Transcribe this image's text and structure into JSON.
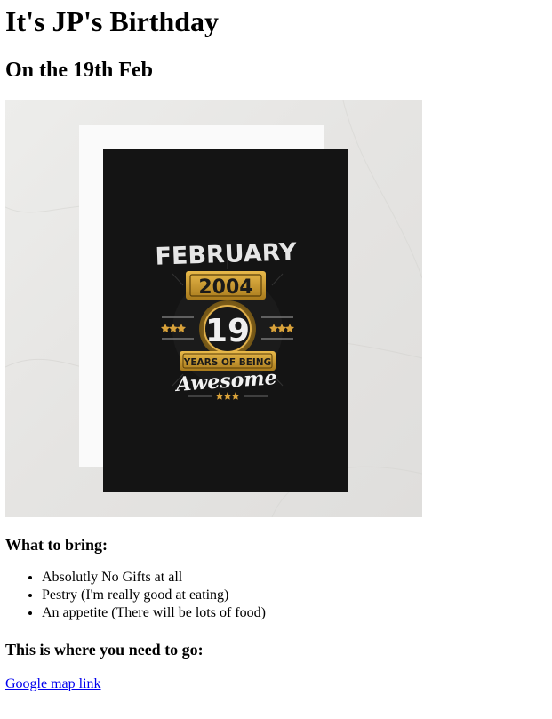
{
  "heading": "It's JP's Birthday",
  "subheading": "On the 19th Feb",
  "card": {
    "month": "FEBRUARY",
    "year": "2004",
    "age": "19",
    "years_of_being": "YEARS OF BEING",
    "awesome": "Awesome",
    "colors": {
      "background": "#e9e8e6",
      "card_white": "#fafafa",
      "card_black": "#141414",
      "gold": "#c99a2e",
      "silver": "#e6e6e6"
    }
  },
  "bring": {
    "title": "What to bring:",
    "items": [
      "Absolutly No Gifts at all",
      "Pestry (I'm really good at eating)",
      "An appetite (There will be lots of food)"
    ]
  },
  "location": {
    "title": "This is where you need to go:",
    "link_text": "Google map link"
  }
}
